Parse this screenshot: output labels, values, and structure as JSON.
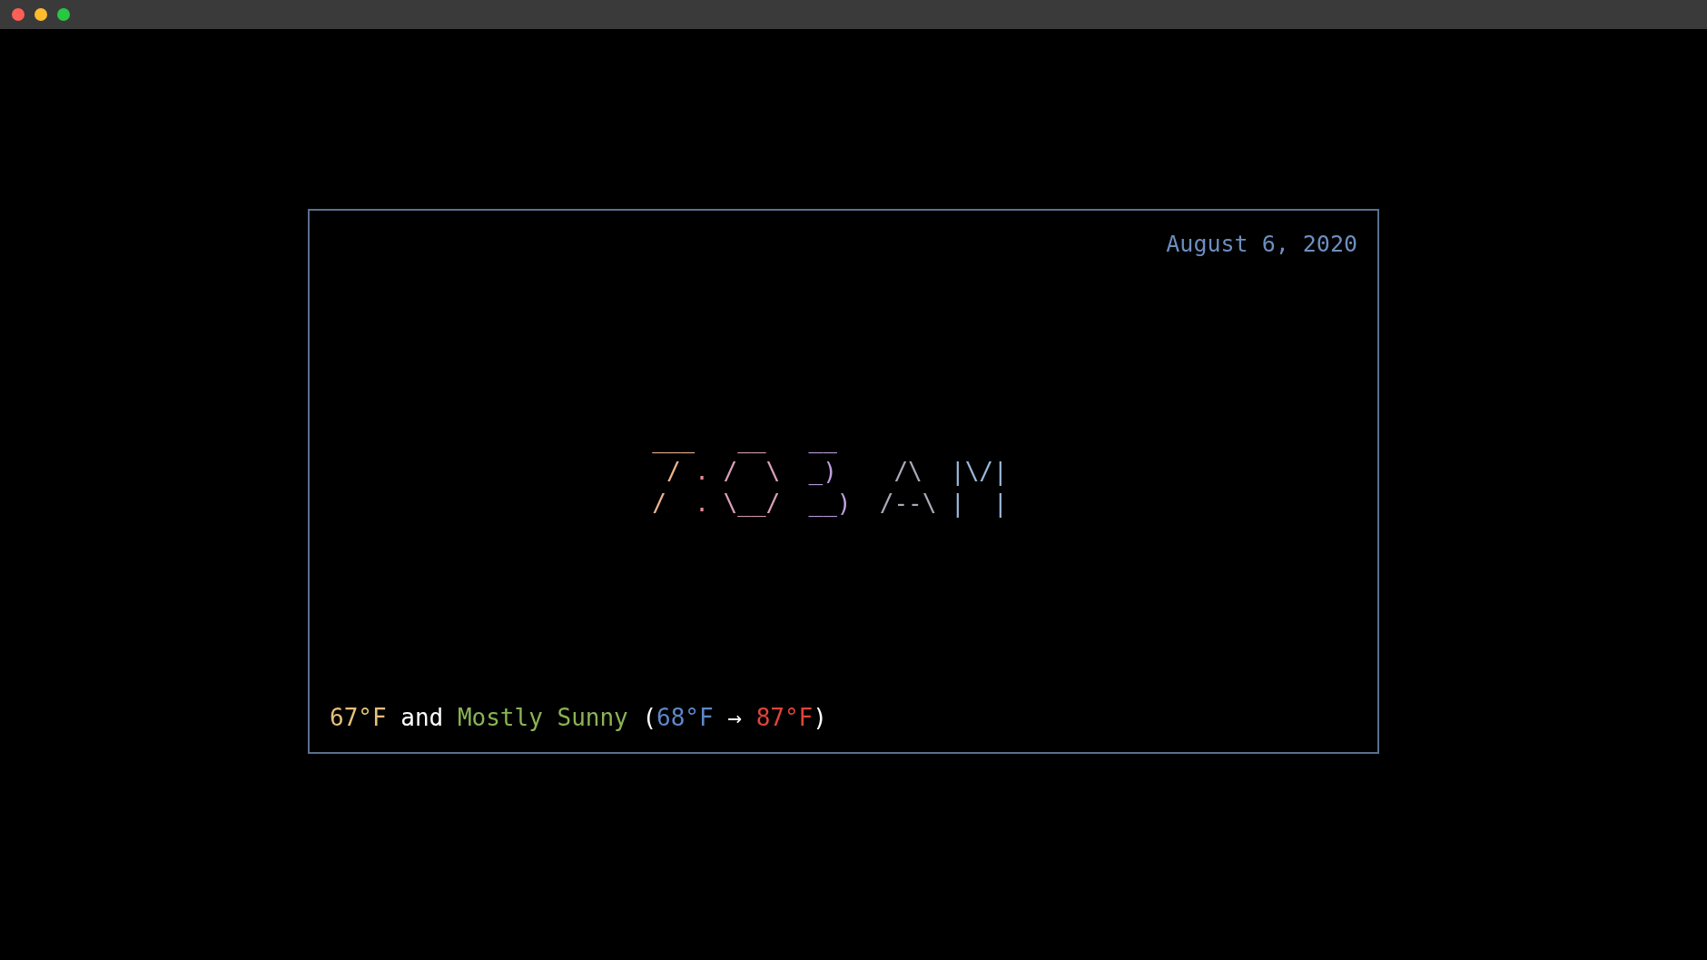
{
  "window": {
    "controls": [
      {
        "color": "#fe5f57"
      },
      {
        "color": "#febc2e"
      },
      {
        "color": "#28c840"
      }
    ]
  },
  "date": "August 6, 2020",
  "clock": {
    "glyphs": [
      {
        "lines": [
          "___",
          " / ",
          "/  "
        ],
        "color": "#f0b48c"
      },
      {
        "lines": [
          ".",
          "."
        ],
        "color": "#e8899a"
      },
      {
        "lines": [
          "  __ ",
          " /  \\",
          " \\__/"
        ],
        "color": "#d8a0b8"
      },
      {
        "lines": [
          "  __ ",
          "  _)",
          "  __)"
        ],
        "color": "#c0a0e0"
      },
      {
        "lines": [
          "   /\\ ",
          "  /--\\"
        ],
        "color": "#a8aab8"
      },
      {
        "lines": [
          " |\\/|",
          " |  |"
        ],
        "color": "#9ab8d8"
      }
    ]
  },
  "weather": [
    {
      "text": "67°F",
      "color": "#e5c07b"
    },
    {
      "text": " and ",
      "color": "#ffffff"
    },
    {
      "text": "Mostly Sunny",
      "color": "#8ab456"
    },
    {
      "text": " (",
      "color": "#ffffff"
    },
    {
      "text": "68°F",
      "color": "#5f87c8"
    },
    {
      "text": " → ",
      "color": "#ffffff"
    },
    {
      "text": "87°F",
      "color": "#e0443a"
    },
    {
      "text": ")",
      "color": "#ffffff"
    }
  ]
}
